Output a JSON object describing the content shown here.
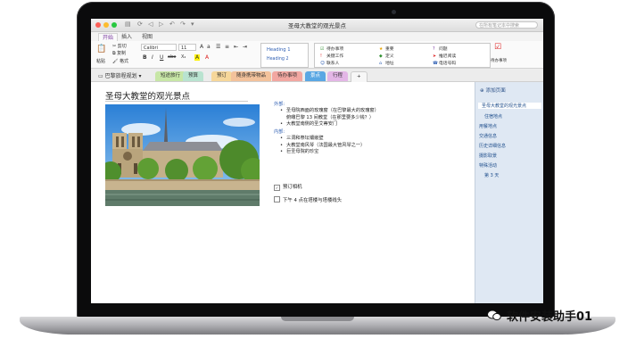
{
  "window": {
    "title": "圣母大教堂的观光景点",
    "search_placeholder": "在所有笔记本中搜索"
  },
  "ribbon": {
    "tabs": [
      "开始",
      "插入",
      "视图"
    ],
    "clipboard": {
      "paste": "粘贴",
      "cut": "剪切",
      "copy": "复制",
      "format": "格式"
    },
    "font": {
      "name": "Calibri",
      "size": "11"
    },
    "format_buttons": [
      "B",
      "I",
      "U",
      "abe",
      "X₂",
      "A",
      "A"
    ],
    "styles": {
      "h1": "Heading 1",
      "h2": "Heading 2"
    },
    "tags": [
      "待办事项",
      "重要",
      "问题",
      "关键工作",
      "定义",
      "推迟阅读",
      "联系人",
      "地址",
      "电话号码"
    ],
    "todo_button": "待办事项"
  },
  "notebook": {
    "name": "巴黎旅程规划",
    "sections": [
      {
        "label": "短途旅行",
        "color": "#c7e6a6"
      },
      {
        "label": "预算",
        "color": "#b9e3d0"
      },
      {
        "label": "预订",
        "color": "#f6d79a"
      },
      {
        "label": "随身携带物品",
        "color": "#f3c29b"
      },
      {
        "label": "待办事项",
        "color": "#f2a7a1"
      },
      {
        "label": "景点",
        "color": "#a9d2f0"
      },
      {
        "label": "行程",
        "color": "#e3b6e6"
      }
    ],
    "add_section": "+"
  },
  "page": {
    "title": "圣母大教堂的观光景点",
    "outside_heading": "外部:",
    "outside_items": [
      {
        "text": "圣母院西面的玫瑰窗（在巴黎最大的玫瑰窗）",
        "cont": "俯瞰巴黎 13 间教堂（在那里要多少钱？）"
      },
      {
        "text": "大教堂南侧的圣艾蒂安门",
        "cont": ""
      }
    ],
    "inside_heading": "内部:",
    "inside_items": [
      "三洞和祭坛镶嵌壁",
      "大教堂南风琴（法国最大管风琴之一）",
      "巨圣母院的珍宝"
    ],
    "checks": [
      {
        "text": "预订相机",
        "checked": true
      },
      {
        "text": "下午 4 点在塔楼与塔楼线头",
        "checked": false
      }
    ]
  },
  "pages_pane": {
    "add_page": "添加页面",
    "items": [
      "圣母大教堂的观光景点",
      "住宿地点",
      "用餐地点",
      "交通信息",
      "历史详细信息",
      "摄影取景",
      "特殊活动",
      "第 3 天"
    ]
  },
  "watermark": {
    "text": "软件安装助手01"
  },
  "colors": {
    "accent": "#7a3aa0",
    "link": "#1f4e8c",
    "pane": "#dfe8f3"
  }
}
